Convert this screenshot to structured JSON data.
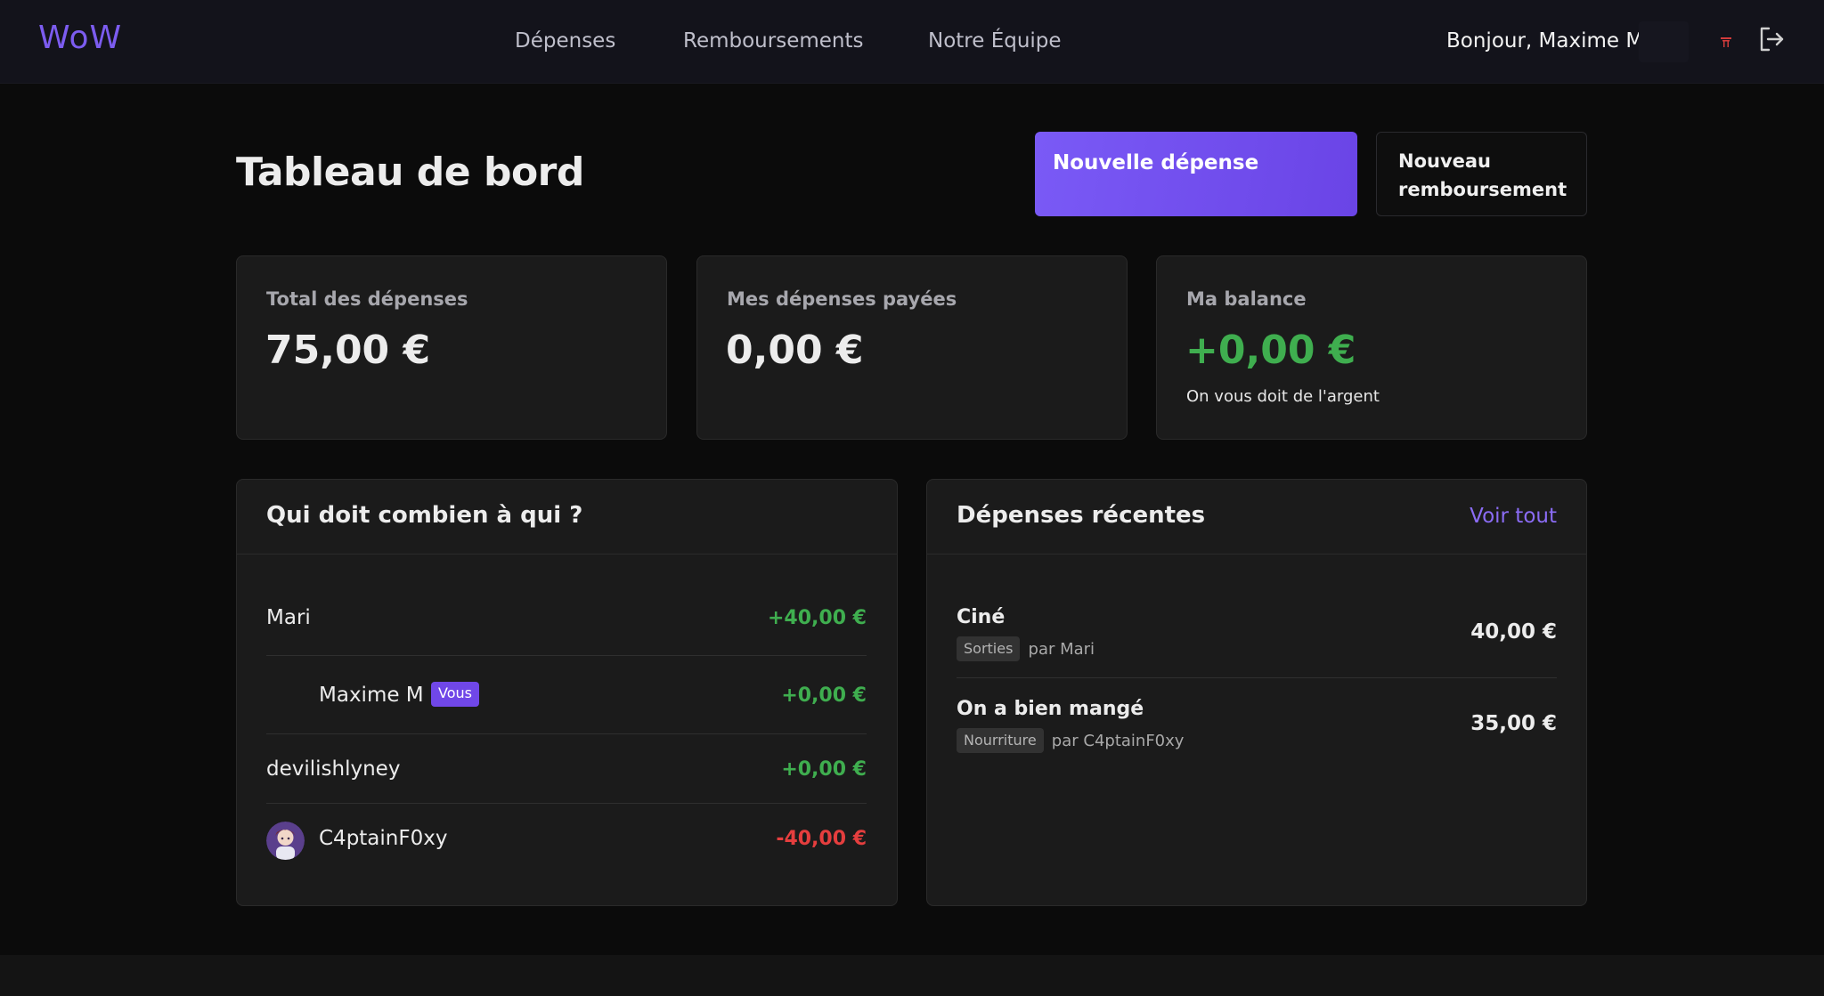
{
  "nav": {
    "logo": "WoW",
    "links": [
      "Dépenses",
      "Remboursements",
      "Notre Équipe"
    ],
    "greeting": "Bonjour, Maxime M"
  },
  "page": {
    "title": "Tableau de bord",
    "actions": {
      "new_expense": "Nouvelle dépense",
      "new_reimbursement_line1": "Nouveau",
      "new_reimbursement_line2": "remboursement"
    }
  },
  "stats": [
    {
      "label": "Total des dépenses",
      "value": "75,00 €",
      "note": ""
    },
    {
      "label": "Mes dépenses payées",
      "value": "0,00 €",
      "note": ""
    },
    {
      "label": "Ma balance",
      "value": "+0,00 €",
      "note": "On vous doit de l'argent"
    }
  ],
  "debts": {
    "title": "Qui doit combien à qui ?",
    "rows": [
      {
        "name": "Mari",
        "amount": "+40,00 €",
        "sign": "positive"
      },
      {
        "name": "Maxime M",
        "amount": "+0,00 €",
        "sign": "positive",
        "badge": "Vous"
      },
      {
        "name": "devilishlyney",
        "amount": "+0,00 €",
        "sign": "positive"
      },
      {
        "name": "C4ptainF0xy",
        "amount": "-40,00 €",
        "sign": "negative"
      }
    ]
  },
  "recent": {
    "title": "Dépenses récentes",
    "see_all": "Voir tout",
    "rows": [
      {
        "title": "Ciné",
        "tag": "Sorties",
        "by": "par Mari",
        "amount": "40,00 €"
      },
      {
        "title": "On a bien mangé",
        "tag": "Nourriture",
        "by": "par C4ptainF0xy",
        "amount": "35,00 €"
      }
    ]
  },
  "colors": {
    "accent": "#7c5cf0",
    "positive": "#3fae4f",
    "negative": "#e53e3e",
    "background": "#0b0b0b",
    "card": "#1b1b1b"
  },
  "icons": [
    "flag-icon",
    "logout-icon",
    "member-avatar"
  ]
}
